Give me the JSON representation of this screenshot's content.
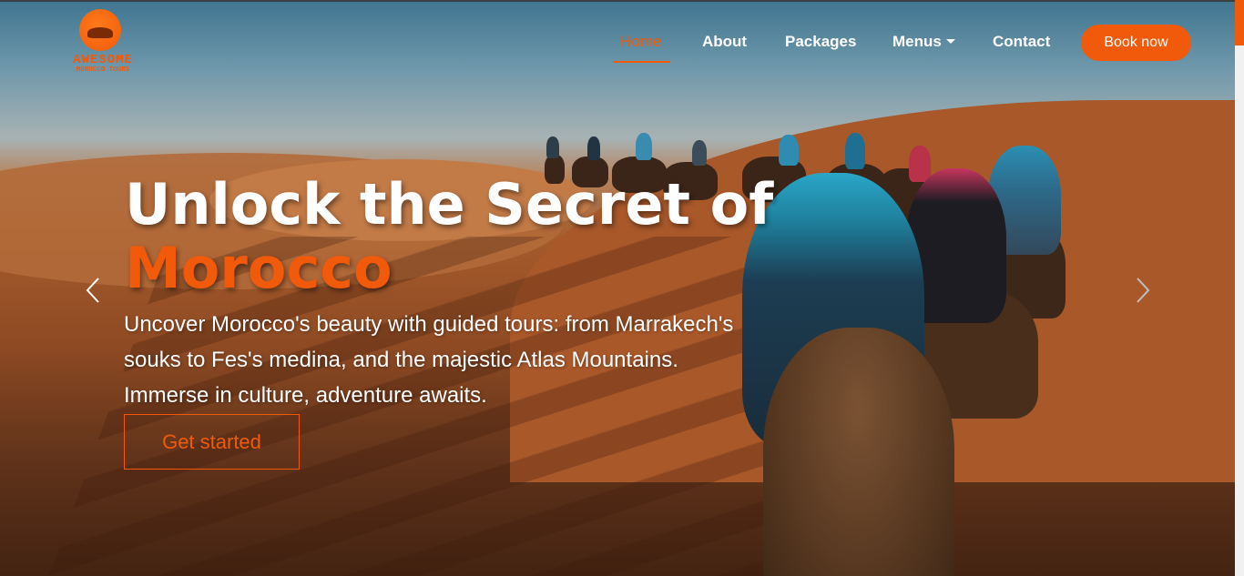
{
  "brand": {
    "title": "AWESOME",
    "subtitle": "MOROCCO TOURS",
    "accent_color": "#f05a0a"
  },
  "nav": {
    "items": [
      {
        "label": "Home",
        "active": true
      },
      {
        "label": "About",
        "active": false
      },
      {
        "label": "Packages",
        "active": false
      },
      {
        "label": "Menus",
        "active": false,
        "dropdown": true
      },
      {
        "label": "Contact",
        "active": false
      }
    ],
    "book_label": "Book now"
  },
  "hero": {
    "headline_line1": "Unlock the Secret of",
    "headline_line2": "Morocco",
    "description": "Uncover Morocco's beauty with guided tours: from Marrakech's souks to Fes's medina, and the majestic Atlas Mountains. Immerse in culture, adventure awaits.",
    "cta_label": "Get started",
    "prev_icon": "chevron-left-icon",
    "next_icon": "chevron-right-icon"
  }
}
